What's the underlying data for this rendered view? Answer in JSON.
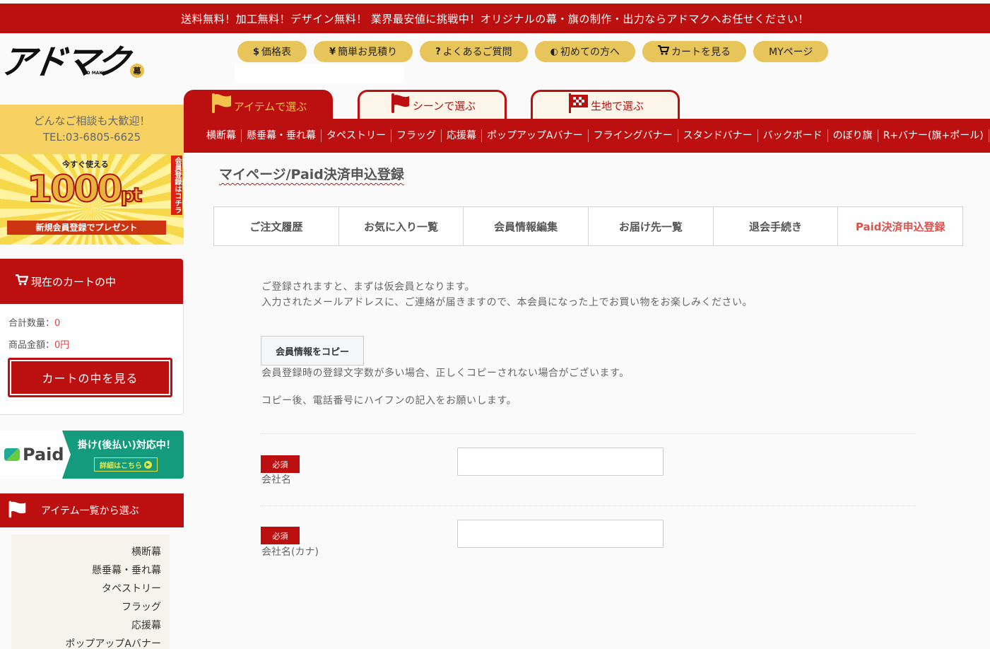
{
  "topbar": {
    "text": "送料無料！加工無料！デザイン無料！ 業界最安値に挑戦中！オリジナルの幕・旗の制作・出力ならアドマクへお任せください！"
  },
  "logo": {
    "text": "アドマク",
    "sub": "AD MAKU",
    "badge": "幕"
  },
  "header_buttons": [
    {
      "icon": "$",
      "label": "価格表"
    },
    {
      "icon": "¥",
      "label": "簡単お見積り"
    },
    {
      "icon": "?",
      "label": "よくあるご質問"
    },
    {
      "icon": "◐",
      "label": "初めての方へ"
    },
    {
      "icon": "🛒",
      "label": "カートを見る"
    },
    {
      "icon": "",
      "label": "MYページ"
    }
  ],
  "category_tabs": [
    {
      "label": "アイテムで選ぶ",
      "active": true
    },
    {
      "label": "シーンで選ぶ",
      "active": false
    },
    {
      "label": "生地で選ぶ",
      "active": false
    }
  ],
  "nav_items": [
    "横断幕",
    "懸垂幕・垂れ幕",
    "タペストリー",
    "フラッグ",
    "応援幕",
    "ポップアップAバナー",
    "フライングバナー",
    "スタンドバナー",
    "バックボード",
    "のぼり旗",
    "R+バナー(旗+ポール)"
  ],
  "sidebar": {
    "contact_line1": "どんなご相談も大歓迎！",
    "contact_line2": "TEL:03-6805-6625",
    "promo": {
      "top": "今すぐ使える",
      "amount": "1000",
      "unit": "pt",
      "ribbon": "新規会員登録でプレゼント",
      "side": "会員登録はコチラ"
    },
    "cart": {
      "title": "現在のカートの中",
      "qty_label": "合計数量：",
      "qty_value": "0",
      "amount_label": "商品金額：",
      "amount_value": "0円",
      "button": "カートの中を見る"
    },
    "paid_banner": {
      "brand": "Paid",
      "title": "掛け(後払い)対応中！",
      "detail": "詳細はこちら"
    },
    "item_list_title": "アイテム一覧から選ぶ",
    "item_list": [
      "横断幕",
      "懸垂幕・垂れ幕",
      "タペストリー",
      "フラッグ",
      "応援幕",
      "ポップアップAバナー"
    ]
  },
  "main": {
    "title": "マイページ/Paid決済申込登録",
    "mypage_tabs": [
      {
        "label": "ご注文履歴",
        "current": false
      },
      {
        "label": "お気に入り一覧",
        "current": false
      },
      {
        "label": "会員情報編集",
        "current": false
      },
      {
        "label": "お届け先一覧",
        "current": false
      },
      {
        "label": "退会手続き",
        "current": false
      },
      {
        "label": "Paid決済申込登録",
        "current": true
      }
    ],
    "intro_line1": "ご登録されますと、まずは仮会員となります。",
    "intro_line2": "入力されたメールアドレスに、ご連絡が届きますので、本会員になった上でお買い物をお楽しみください。",
    "copy_button": "会員情報をコピー",
    "note1": "会員登録時の登録文字数が多い場合、正しくコピーされない場合がございます。",
    "note2": "コピー後、電話番号にハイフンの記入をお願いします。",
    "fields": [
      {
        "required": "必須",
        "label": "会社名",
        "value": ""
      },
      {
        "required": "必須",
        "label": "会社名(カナ)",
        "value": ""
      }
    ]
  },
  "colors": {
    "brand_red": "#bc0f0f",
    "accent_yellow": "#e8c55a",
    "paid_green": "#149a7c",
    "current_tab": "#d9534f"
  }
}
